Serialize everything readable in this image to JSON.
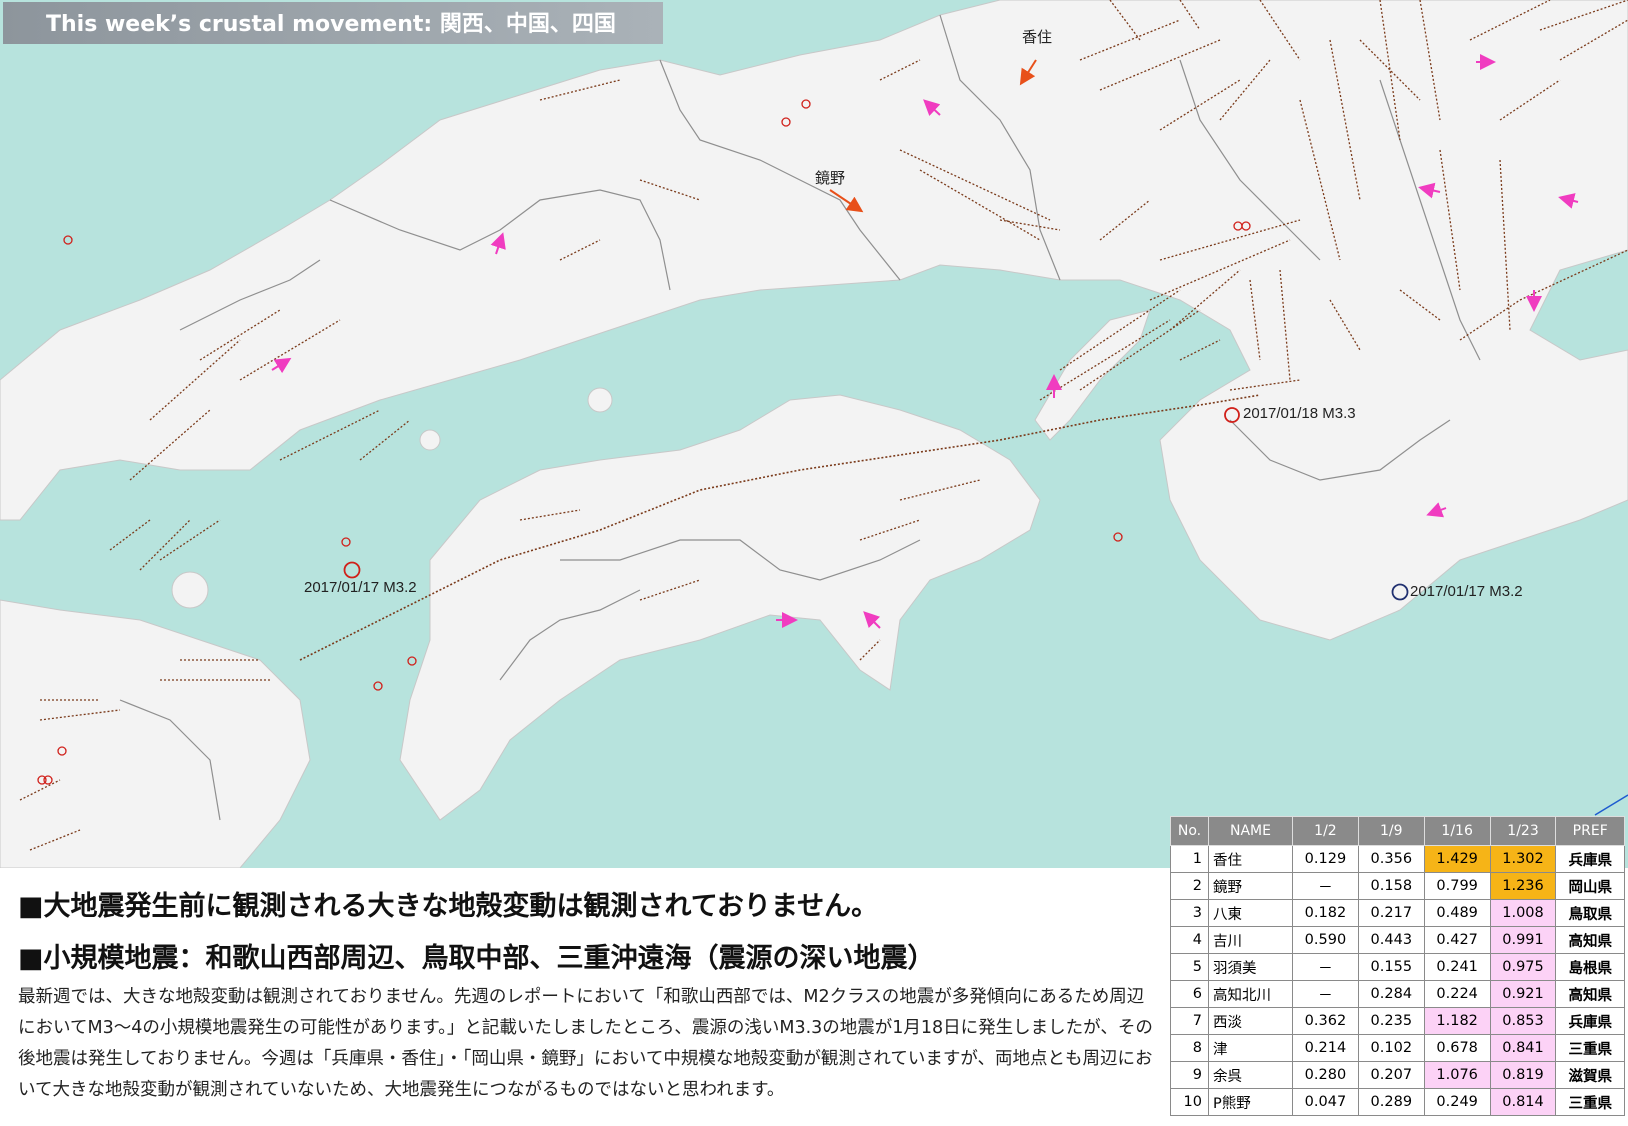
{
  "title": "This week’s crustal movement: 関西、中国、四国",
  "colors": {
    "sea": "#b7e3dd",
    "land": "#f4f4f4",
    "fault": "#7a3a1a",
    "vector_orange": "#e8501a",
    "vector_pink": "#f03cc0",
    "quake_red": "#d0201a",
    "quake_blue": "#203070",
    "highlight_orange": "#f6b417",
    "highlight_pink": "#fcd2f6"
  },
  "map": {
    "station_labels": {
      "kasumi": "香住",
      "kagamino": "鏡野"
    },
    "quake_labels": {
      "wakayama": "2017/01/18 M3.3",
      "shikoku": "2017/01/17 M3.2",
      "mie": "2017/01/17 M3.2"
    }
  },
  "headlines": [
    "■大地震発生前に観測される大きな地殻変動は観測されておりません。",
    "■小規模地震：和歌山西部周辺、鳥取中部、三重沖遠海（震源の深い地震）"
  ],
  "body": "最新週では、大きな地殻変動は観測されておりません。先週のレポートにおいて「和歌山西部では、M2クラスの地震が多発傾向にあるため周辺においてM3～4の小規模地震発生の可能性があります。」と記載いたしましたところ、震源の浅いM3.3の地震が1月18日に発生しましたが、その後地震は発生しておりません。今週は「兵庫県・香住」・「岡山県・鏡野」において中規模な地殻変動が観測されていますが、両地点とも周辺において大きな地殻変動が観測されていないため、大地震発生につながるものではないと思われます。",
  "table": {
    "headers": [
      "No.",
      "NAME",
      "1/2",
      "1/9",
      "1/16",
      "1/23",
      "PREF"
    ],
    "rows": [
      {
        "no": "1",
        "name": "香住",
        "v1": "0.129",
        "v2": "0.356",
        "v3": "1.429",
        "v4": "1.302",
        "pref": "兵庫県",
        "h3": "o",
        "h4": "o"
      },
      {
        "no": "2",
        "name": "鏡野",
        "v1": "－",
        "v2": "0.158",
        "v3": "0.799",
        "v4": "1.236",
        "pref": "岡山県",
        "h3": "",
        "h4": "o"
      },
      {
        "no": "3",
        "name": "八東",
        "v1": "0.182",
        "v2": "0.217",
        "v3": "0.489",
        "v4": "1.008",
        "pref": "鳥取県",
        "h3": "",
        "h4": "p"
      },
      {
        "no": "4",
        "name": "吉川",
        "v1": "0.590",
        "v2": "0.443",
        "v3": "0.427",
        "v4": "0.991",
        "pref": "高知県",
        "h3": "",
        "h4": "p"
      },
      {
        "no": "5",
        "name": "羽須美",
        "v1": "－",
        "v2": "0.155",
        "v3": "0.241",
        "v4": "0.975",
        "pref": "島根県",
        "h3": "",
        "h4": "p"
      },
      {
        "no": "6",
        "name": "高知北川",
        "v1": "－",
        "v2": "0.284",
        "v3": "0.224",
        "v4": "0.921",
        "pref": "高知県",
        "h3": "",
        "h4": "p"
      },
      {
        "no": "7",
        "name": "西淡",
        "v1": "0.362",
        "v2": "0.235",
        "v3": "1.182",
        "v4": "0.853",
        "pref": "兵庫県",
        "h3": "p",
        "h4": "p"
      },
      {
        "no": "8",
        "name": "津",
        "v1": "0.214",
        "v2": "0.102",
        "v3": "0.678",
        "v4": "0.841",
        "pref": "三重県",
        "h3": "",
        "h4": "p"
      },
      {
        "no": "9",
        "name": "余呉",
        "v1": "0.280",
        "v2": "0.207",
        "v3": "1.076",
        "v4": "0.819",
        "pref": "滋賀県",
        "h3": "p",
        "h4": "p"
      },
      {
        "no": "10",
        "name": "P熊野",
        "v1": "0.047",
        "v2": "0.289",
        "v3": "0.249",
        "v4": "0.814",
        "pref": "三重県",
        "h3": "",
        "h4": "p"
      }
    ]
  }
}
